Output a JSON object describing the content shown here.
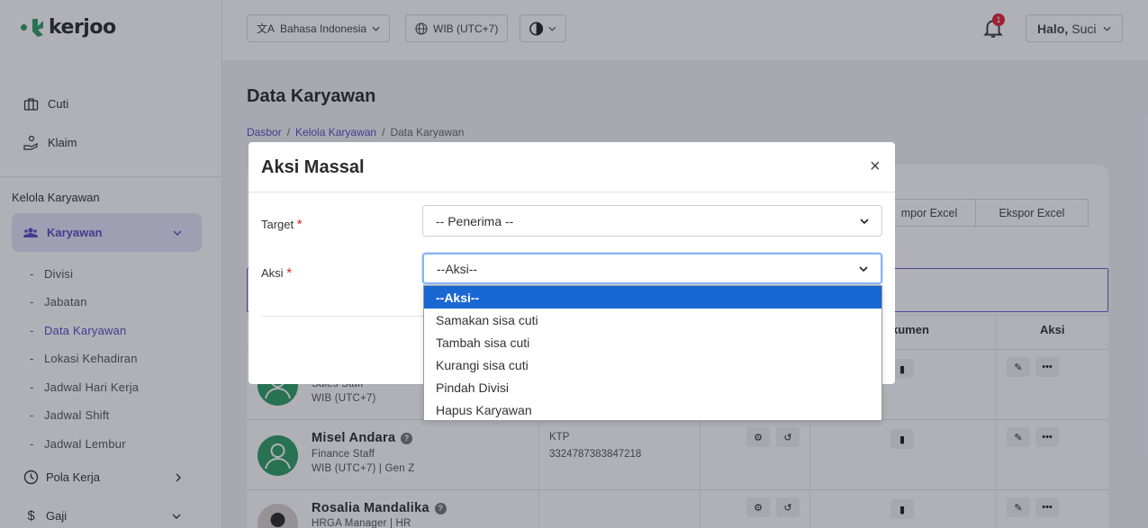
{
  "logo": {
    "text": "KerJoo",
    "color": "#2f9e63"
  },
  "sidebar": {
    "top_items": [
      {
        "label": "Cuti",
        "icon": "briefcase-icon"
      },
      {
        "label": "Klaim",
        "icon": "hand-coin-icon"
      }
    ],
    "section_label": "Kelola Karyawan",
    "active_group": {
      "label": "Karyawan",
      "icon": "users-icon"
    },
    "sub_items": [
      "Divisi",
      "Jabatan",
      "Data Karyawan",
      "Lokasi Kehadiran",
      "Jadwal Hari Kerja",
      "Jadwal Shift",
      "Jadwal Lembur"
    ],
    "active_sub": "Data Karyawan",
    "groups": [
      {
        "label": "Pola Kerja",
        "icon": "clock-icon"
      },
      {
        "label": "Gaji",
        "icon": "dollar-icon"
      }
    ]
  },
  "topbar": {
    "language": "Bahasa Indonesia",
    "timezone": "WIB (UTC+7)",
    "notifications": "1",
    "greeting": "Halo,",
    "user": "Suci"
  },
  "main": {
    "title": "Data Karyawan",
    "breadcrumb": [
      "Dasbor",
      "/",
      "Kelola Karyawan",
      "/",
      "Data Karyawan"
    ],
    "import_label": "Impor Excel",
    "import_partial": "mpor Excel",
    "export_label": "Ekspor Excel",
    "headers": {
      "dokumen_partial": "kumen",
      "aksi": "Aksi"
    },
    "rows": [
      {
        "name": "",
        "role": "Sales Staff",
        "meta": "WIB (UTC+7)"
      },
      {
        "name": "Misel Andara",
        "role": "Finance Staff",
        "meta": "WIB (UTC+7) | Gen Z",
        "doc_type": "KTP",
        "doc_no": "3324787383847218"
      },
      {
        "name": "Rosalia Mandalika",
        "role": "HRGA Manager | HR",
        "meta": ""
      }
    ]
  },
  "modal": {
    "title": "Aksi Massal",
    "close": "×",
    "target_label": "Target",
    "target_value": "-- Penerima --",
    "aksi_label": "Aksi",
    "aksi_value": "--Aksi--",
    "required_mark": "*",
    "options": [
      "--Aksi--",
      "Samakan sisa cuti",
      "Tambah sisa cuti",
      "Kurangi sisa cuti",
      "Pindah Divisi",
      "Hapus Karyawan"
    ],
    "selected_option": "--Aksi--"
  },
  "colors": {
    "accent": "#5b4cc4",
    "brand": "#2f9e63",
    "selected": "#1967d2",
    "danger": "#e0242f"
  }
}
